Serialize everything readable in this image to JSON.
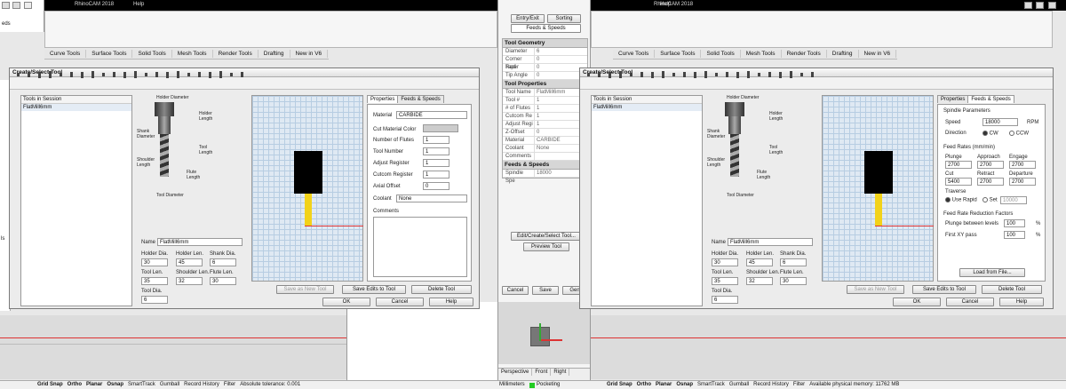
{
  "left_app": {
    "title": "RhinoCAM 2018",
    "menu_item": "Help",
    "side_label_1": "eds",
    "side_label_2": "ls",
    "tabs": [
      "Curve Tools",
      "Surface Tools",
      "Solid Tools",
      "Mesh Tools",
      "Render Tools",
      "Drafting",
      "New in V6"
    ]
  },
  "right_app": {
    "title": "RhinoCAM 2018",
    "menu_item": "Help",
    "tabs": [
      "Curve Tools",
      "Surface Tools",
      "Solid Tools",
      "Mesh Tools",
      "Render Tools",
      "Drafting",
      "New in V6"
    ]
  },
  "middle_panel": {
    "entry_exit": "Entry/Exit",
    "sorting": "Sorting",
    "feeds_speeds_tab": "Feeds & Speeds",
    "tool_geometry_header": "Tool Geometry",
    "tool_geometry_rows": [
      {
        "k": "Diameter",
        "v": "6"
      },
      {
        "k": "Corner Radi",
        "v": "0"
      },
      {
        "k": "Taper",
        "v": "0"
      },
      {
        "k": "Tip Angle",
        "v": "0"
      }
    ],
    "tool_properties_header": "Tool Properties",
    "tool_properties_rows": [
      {
        "k": "Tool Name",
        "v": "FlatMill6mm"
      },
      {
        "k": "Tool #",
        "v": "1"
      },
      {
        "k": "# of Flutes",
        "v": "1"
      },
      {
        "k": "Cutcom Re",
        "v": "1"
      },
      {
        "k": "Adjust Regi",
        "v": "1"
      },
      {
        "k": "Z-Offset",
        "v": "0"
      },
      {
        "k": "Material",
        "v": "CARBIDE"
      },
      {
        "k": "Coolant",
        "v": "None"
      },
      {
        "k": "Comments",
        "v": ""
      }
    ],
    "feeds_header": "Feeds & Speeds",
    "feeds_rows": [
      {
        "k": "Spindle Spe",
        "v": "18000"
      }
    ],
    "edit_tool_button": "Edit/Create/Select Tool...",
    "preview_tool_button": "Preview Tool",
    "cancel": "Cancel",
    "save": "Save",
    "generate": "Gen"
  },
  "dialog_left": {
    "title": "Create/Select Tool",
    "tools_in_session": "Tools in Session",
    "tool_item": "FlatMill6mm",
    "diagram_labels": {
      "holder_diameter": "Holder Diameter",
      "holder_length": "Holder Length",
      "shank_diameter": "Shank Diameter",
      "tool_length": "Tool Length",
      "shoulder_length": "Shoulder Length",
      "flute_length": "Flute Length",
      "tool_diameter": "Tool Diameter"
    },
    "name_label": "Name",
    "name_value": "FlatMill6mm",
    "holder_dia_label": "Holder Dia.",
    "holder_dia": "30",
    "holder_len_label": "Holder Len.",
    "holder_len": "45",
    "shank_dia_label": "Shank Dia.",
    "shank_dia": "6",
    "tool_len_label": "Tool Len.",
    "tool_len": "35",
    "shoulder_len_label": "Shoulder Len.",
    "shoulder_len": "32",
    "flute_len_label": "Flute Len.",
    "flute_len": "30",
    "tool_dia_label": "Tool Dia.",
    "tool_dia": "6",
    "tabs": [
      "Properties",
      "Feeds & Speeds"
    ],
    "material_label": "Material",
    "material_value": "CARBIDE",
    "color_label": "Cut Material Color",
    "num_flutes_label": "Number of Flutes",
    "num_flutes": "1",
    "tool_number_label": "Tool Number",
    "tool_number": "1",
    "adjust_reg_label": "Adjust Register",
    "adjust_reg": "1",
    "cutcom_label": "Cutcom Register",
    "cutcom": "1",
    "axial_offset_label": "Axial Offset",
    "axial_offset": "0",
    "coolant_label": "Coolant",
    "coolant_value": "None",
    "comments_label": "Comments",
    "save_new": "Save as New Tool",
    "save_edits": "Save Edits to Tool",
    "delete": "Delete Tool",
    "ok": "OK",
    "cancel": "Cancel",
    "help": "Help"
  },
  "dialog_right": {
    "title": "Create/Select Tool",
    "tools_in_session": "Tools in Session",
    "tool_item": "FlatMill6mm",
    "diagram_labels": {
      "holder_diameter": "Holder Diameter",
      "holder_length": "Holder Length",
      "shank_diameter": "Shank Diameter",
      "tool_length": "Tool Length",
      "shoulder_length": "Shoulder Length",
      "flute_length": "Flute Length",
      "tool_diameter": "Tool Diameter"
    },
    "name_label": "Name",
    "name_value": "FlatMill6mm",
    "holder_dia_label": "Holder Dia.",
    "holder_dia": "30",
    "holder_len_label": "Holder Len.",
    "holder_len": "45",
    "shank_dia_label": "Shank Dia.",
    "shank_dia": "6",
    "tool_len_label": "Tool Len.",
    "tool_len": "35",
    "shoulder_len_label": "Shoulder Len.",
    "shoulder_len": "32",
    "flute_len_label": "Flute Len.",
    "flute_len": "30",
    "tool_dia_label": "Tool Dia.",
    "tool_dia": "6",
    "tabs": [
      "Properties",
      "Feeds & Speeds"
    ],
    "spindle_group": "Spindle Parameters",
    "speed_label": "Speed",
    "speed_value": "18000",
    "rpm": "RPM",
    "direction_label": "Direction",
    "cw": "CW",
    "ccw": "CCW",
    "feed_rates_group": "Feed Rates (mm/min)",
    "plunge_label": "Plunge",
    "plunge": "2700",
    "approach_label": "Approach",
    "approach": "2700",
    "engage_label": "Engage",
    "engage": "2700",
    "cut_label": "Cut",
    "cut": "5400",
    "retract_label": "Retract",
    "retract": "2700",
    "departure_label": "Departure",
    "departure": "2700",
    "traverse_label": "Traverse",
    "use_rapid": "Use Rapid",
    "set_label": "Set",
    "traverse_value": "10000",
    "reduction_group": "Feed Rate Reduction Factors",
    "plunge_between_label": "Plunge between levels",
    "plunge_between": "100",
    "first_xy_label": "First XY pass",
    "first_xy": "100",
    "pct": "%",
    "load_button": "Load from File...",
    "save_new": "Save as New Tool",
    "save_edits": "Save Edits to Tool",
    "delete": "Delete Tool",
    "ok": "OK",
    "cancel": "Cancel",
    "help": "Help"
  },
  "viewport_tabs": [
    "Perspective",
    "Front",
    "Right"
  ],
  "status_left": {
    "items": [
      "Grid Snap",
      "Ortho",
      "Planar",
      "Osnap",
      "SmartTrack",
      "Gumball",
      "Record History",
      "Filter"
    ],
    "message": "Absolute tolerance: 0.001"
  },
  "status_mid": {
    "units": "Millimeters",
    "pocketing": "Pocketing"
  },
  "status_right": {
    "items": [
      "Grid Snap",
      "Ortho",
      "Planar",
      "Osnap",
      "SmartTrack",
      "Gumball",
      "Record History",
      "Filter"
    ],
    "message": "Available physical memory: 11762 MB"
  },
  "colors": {
    "tool_yellow": "#f2d21a",
    "tool_black": "#000000",
    "grid_bg": "#dfe9f3",
    "cut_line": "#dd3333"
  }
}
